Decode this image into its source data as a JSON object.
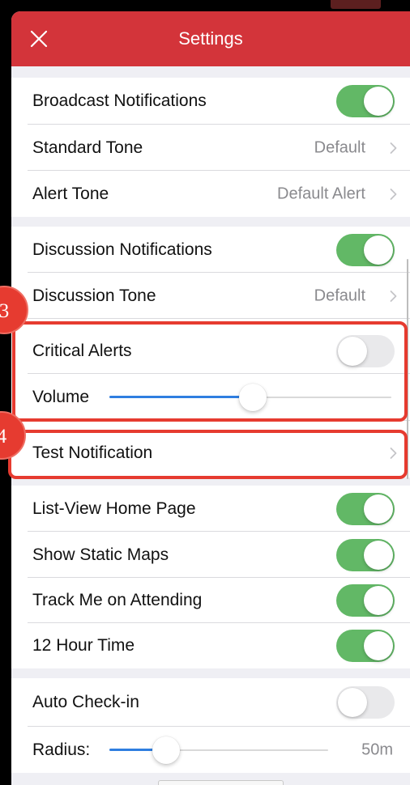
{
  "header": {
    "title": "Settings",
    "close_icon": "close-icon"
  },
  "colors": {
    "header_red": "#d3343a",
    "toggle_on": "#62b866",
    "slider_fill": "#2f7ee0",
    "annotation_red": "#e63b30",
    "background": "#efeff4"
  },
  "sections": [
    {
      "rows": [
        {
          "label": "Broadcast Notifications",
          "toggle_on": true
        },
        {
          "label": "Standard Tone",
          "value": "Default",
          "chevron_icon": "chevron-right-icon"
        },
        {
          "label": "Alert Tone",
          "value": "Default Alert",
          "chevron_icon": "chevron-right-icon"
        }
      ]
    },
    {
      "rows": [
        {
          "label": "Discussion Notifications",
          "toggle_on": true
        },
        {
          "label": "Discussion Tone",
          "value": "Default",
          "chevron_icon": "chevron-right-icon"
        },
        {
          "label": "Critical Alerts",
          "toggle_on": false
        },
        {
          "label": "Volume",
          "slider_level": 0.51
        },
        {
          "label": "Test Notification",
          "chevron_icon": "chevron-right-icon"
        }
      ]
    },
    {
      "rows": [
        {
          "label": "List-View Home Page",
          "toggle_on": true
        },
        {
          "label": "Show Static Maps",
          "toggle_on": true
        },
        {
          "label": "Track Me on Attending",
          "toggle_on": true
        },
        {
          "label": "12 Hour Time",
          "toggle_on": true
        }
      ]
    },
    {
      "rows": [
        {
          "label": "Auto Check-in",
          "toggle_on": false
        },
        {
          "label": "Radius:",
          "slider_level": 0.26,
          "value": "50m"
        }
      ]
    }
  ],
  "annotations": [
    {
      "label": "3"
    },
    {
      "label": "4"
    }
  ]
}
